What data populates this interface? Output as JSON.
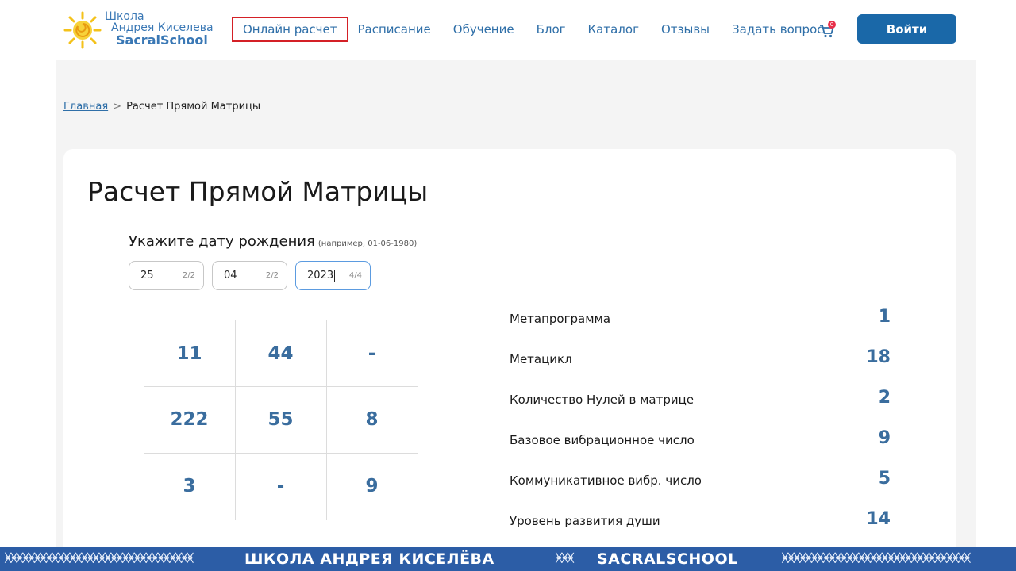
{
  "header": {
    "logo": {
      "line1": "Школа",
      "line2": "Андрея Киселева",
      "line3": "SacralSchool"
    },
    "nav": [
      {
        "label": "Онлайн расчет"
      },
      {
        "label": "Расписание"
      },
      {
        "label": "Обучение"
      },
      {
        "label": "Блог"
      },
      {
        "label": "Каталог"
      },
      {
        "label": "Отзывы"
      },
      {
        "label": "Задать вопрос"
      }
    ],
    "cart_count": "0",
    "login_label": "Войти"
  },
  "breadcrumb": {
    "home": "Главная",
    "sep": ">",
    "current": "Расчет Прямой Матрицы"
  },
  "title": "Расчет Прямой Матрицы",
  "date": {
    "label": "Укажите дату рождения",
    "hint": "(например, 01-06-1980)",
    "day": {
      "value": "25",
      "count": "2/2"
    },
    "month": {
      "value": "04",
      "count": "2/2"
    },
    "year": {
      "value": "2023",
      "count": "4/4"
    }
  },
  "matrix": [
    [
      "11",
      "44",
      "-"
    ],
    [
      "222",
      "55",
      "8"
    ],
    [
      "3",
      "-",
      "9"
    ]
  ],
  "results": [
    {
      "label": "Метапрограмма",
      "value": "1"
    },
    {
      "label": "Метацикл",
      "value": "18"
    },
    {
      "label": "Количество Нулей в матрице",
      "value": "2"
    },
    {
      "label": "Базовое вибрационное число",
      "value": "9"
    },
    {
      "label": "Коммуникативное вибр. число",
      "value": "5"
    },
    {
      "label": "Уровень развития души",
      "value": "14"
    }
  ],
  "footer": {
    "pattern": "ᚸᚸᚸᚸᚸᚸᚸᚸᚸᚸᚸᚸᚸᚸᚸᚸᚸᚸᚸᚸᚸᚸᚸᚸᚸᚸᚸᚸᚸᚸᚸᚸ",
    "mid_pattern": "ᚸᚸᚸ",
    "left_text": "ШКОЛА АНДРЕЯ КИСЕЛЁВА",
    "right_text": "SACRALSCHOOL"
  },
  "colors": {
    "accent": "#1a68a8",
    "value_blue": "#3a6d9e",
    "active_border": "#d42026",
    "footer": "#2c5da6"
  }
}
